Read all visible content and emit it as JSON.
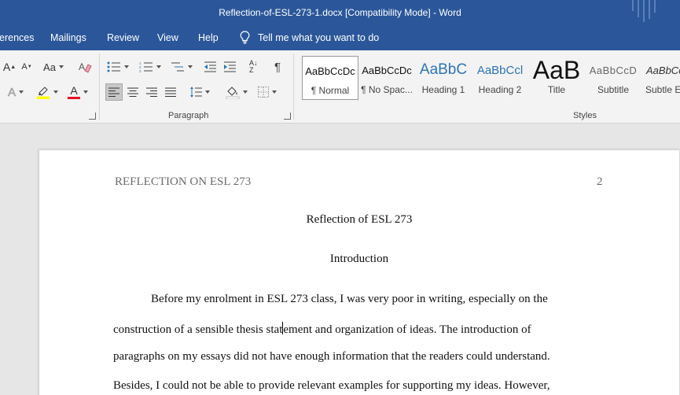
{
  "window": {
    "title": "Reflection-of-ESL-273-1.docx [Compatibility Mode]  -  Word"
  },
  "tabs": [
    {
      "label": "erences"
    },
    {
      "label": "Mailings"
    },
    {
      "label": "Review"
    },
    {
      "label": "View"
    },
    {
      "label": "Help"
    }
  ],
  "tell_me": {
    "label": "Tell me what you want to do",
    "icon": "lightbulb-icon"
  },
  "ribbon": {
    "font_group": {
      "grow_label": "A",
      "shrink_label": "A",
      "case_label": "Aa",
      "effects_label": "A",
      "font_color_label": "A",
      "font_color": "#e81123",
      "highlight_color": "#ffff00"
    },
    "paragraph_group": {
      "label": "Paragraph",
      "sort_label": "A↓Z",
      "pilcrow_label": "¶"
    },
    "styles_group": {
      "label": "Styles",
      "items": [
        {
          "sample": "AaBbCcDc",
          "name": "¶ Normal",
          "active": true
        },
        {
          "sample": "AaBbCcDc",
          "name": "¶ No Spac..."
        },
        {
          "sample": "AaBbC",
          "name": "Heading 1"
        },
        {
          "sample": "AaBbCcl",
          "name": "Heading 2"
        },
        {
          "sample": "AaB",
          "name": "Title"
        },
        {
          "sample": "AaBbCcD",
          "name": "Subtitle"
        },
        {
          "sample": "AaBbCcI",
          "name": "Subtle Em"
        }
      ]
    }
  },
  "colors": {
    "titlebar": "#2b579a",
    "ribbon": "#f3f3f3",
    "heading_blue": "#2e74b5"
  },
  "document": {
    "running_head": "REFLECTION ON ESL 273",
    "page_number": "2",
    "title": "Reflection of ESL 273",
    "heading": "Introduction",
    "lines": [
      {
        "pre": "Before my enrolment in ESL 273 class, I was very poor in writing, especially on the",
        "post": ""
      },
      {
        "pre": "construction of a sensible thesis stat",
        "post": "ement and organization of ideas. The introduction of"
      },
      {
        "pre": "paragraphs on my essays did not have enough information that the readers could understand.",
        "post": ""
      },
      {
        "pre": "Besides, I could not be able to provide relevant examples for supporting my ideas. However,",
        "post": ""
      }
    ]
  }
}
